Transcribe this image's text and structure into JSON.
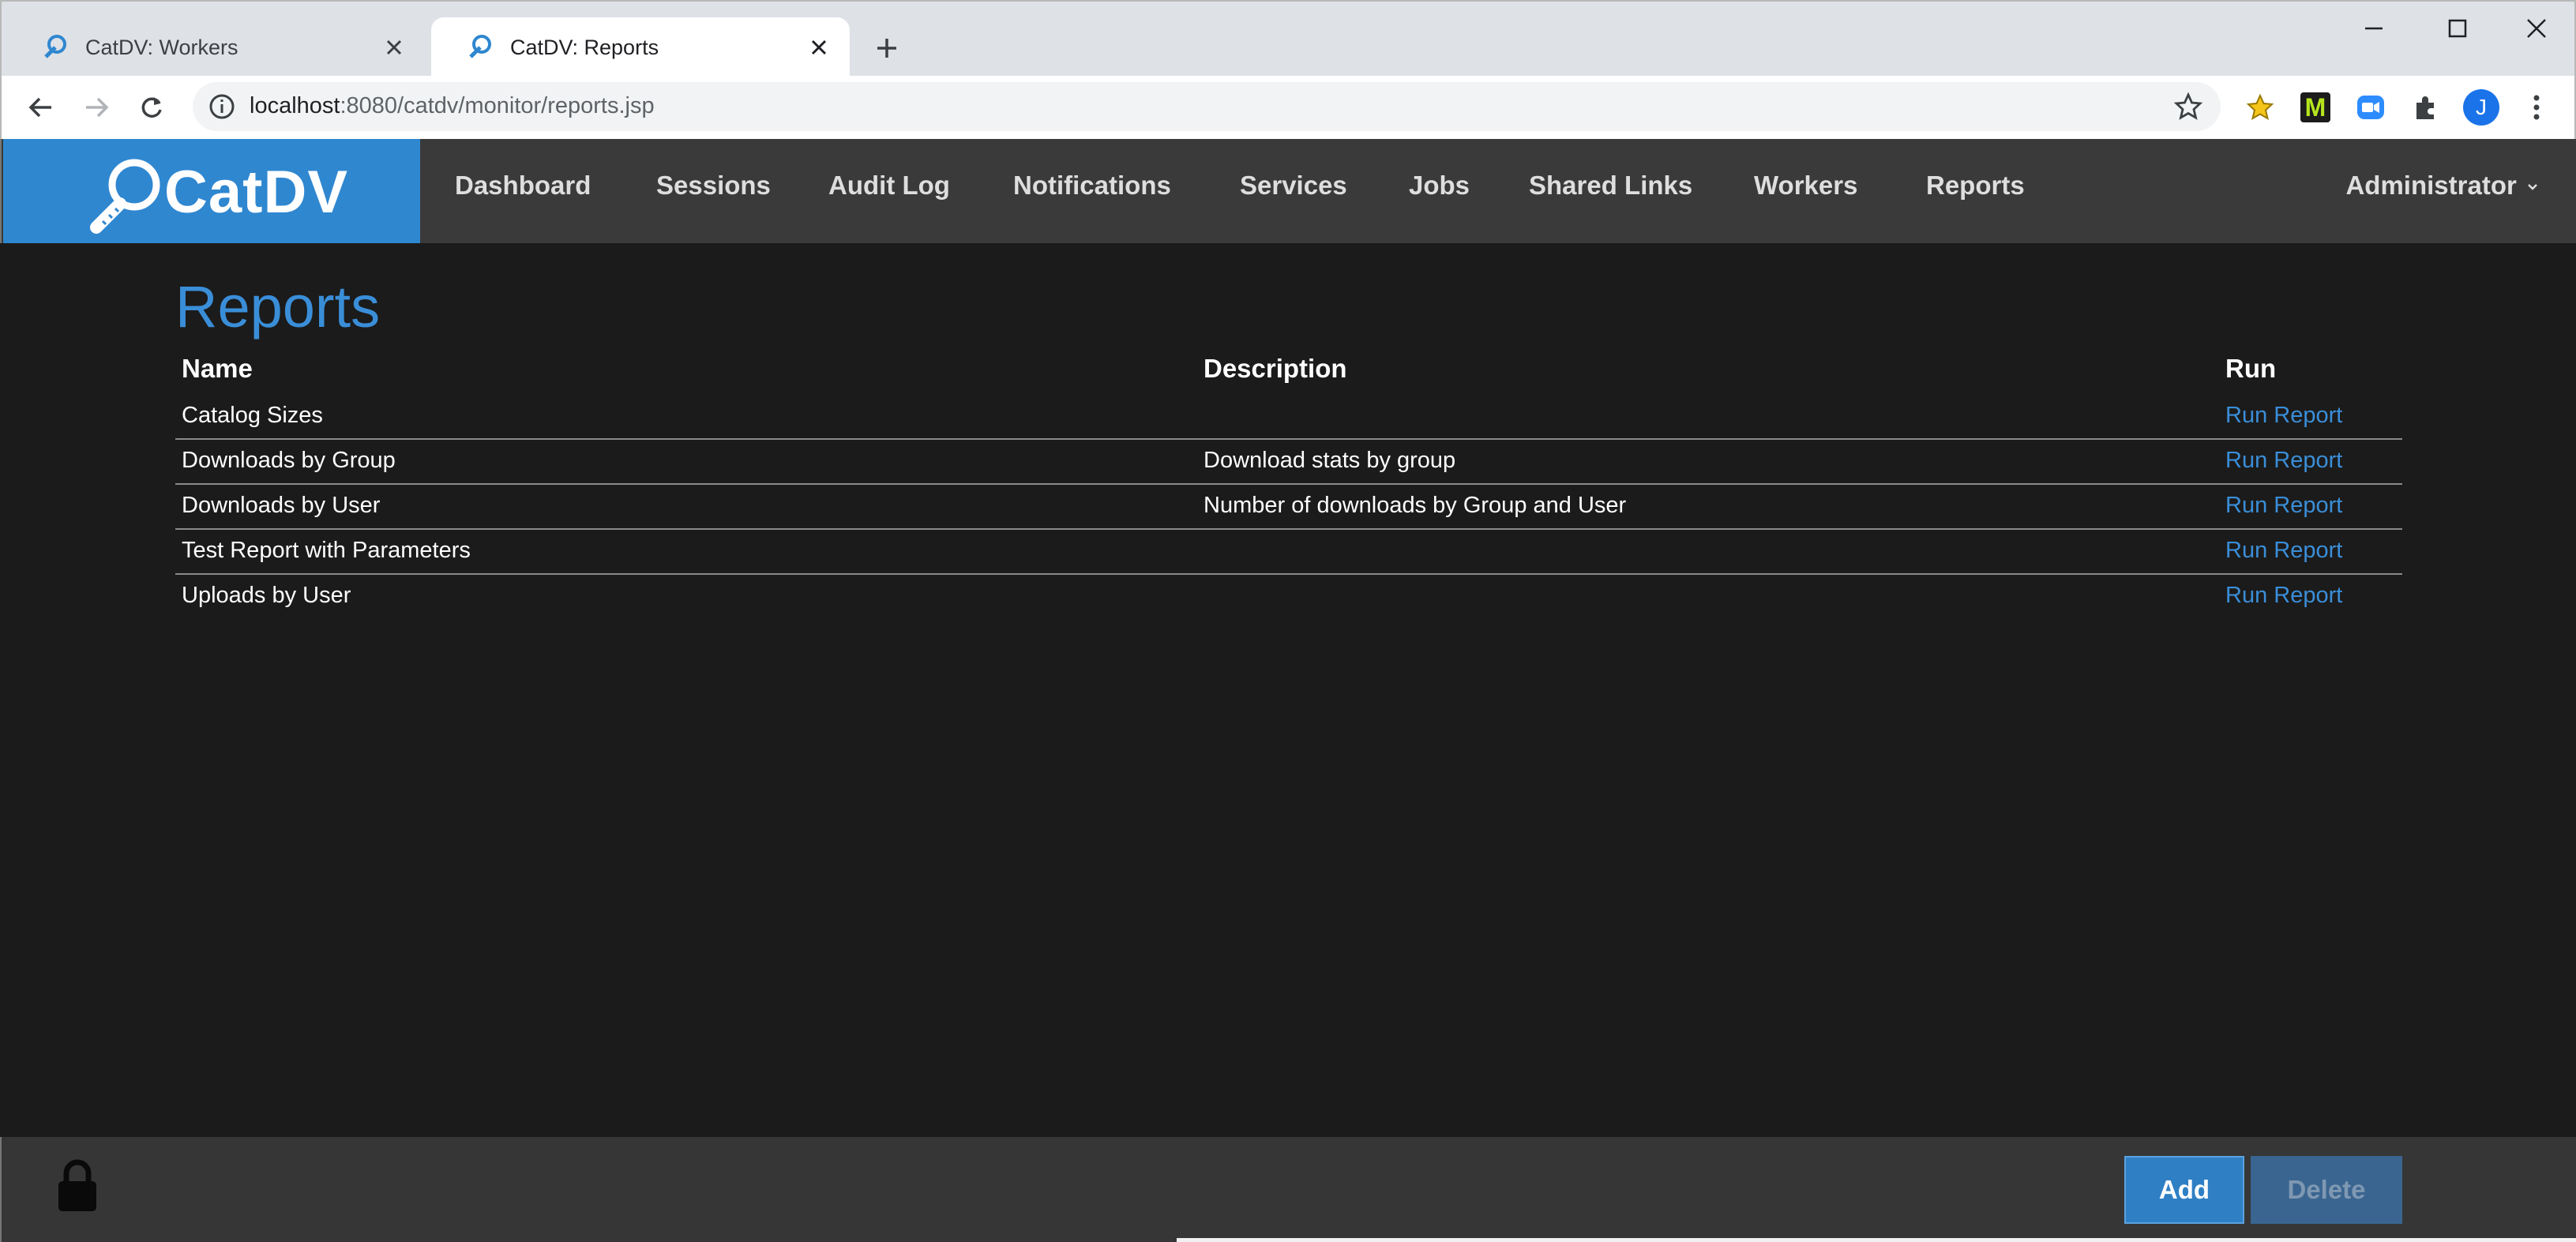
{
  "browser": {
    "tabs": [
      {
        "title": "CatDV: Workers",
        "active": false
      },
      {
        "title": "CatDV: Reports",
        "active": true
      }
    ],
    "url_host": "localhost",
    "url_rest": ":8080/catdv/monitor/reports.jsp",
    "profile_initial": "J",
    "extension_m_label": "M"
  },
  "app": {
    "logo_text": "CatDV",
    "nav": [
      "Dashboard",
      "Sessions",
      "Audit Log",
      "Notifications",
      "Services",
      "Jobs",
      "Shared Links",
      "Workers",
      "Reports"
    ],
    "user_menu": "Administrator"
  },
  "page": {
    "title": "Reports",
    "columns": {
      "name": "Name",
      "description": "Description",
      "run": "Run"
    },
    "rows": [
      {
        "name": "Catalog Sizes",
        "description": "",
        "run": "Run Report"
      },
      {
        "name": "Downloads by Group",
        "description": "Download stats by group",
        "run": "Run Report"
      },
      {
        "name": "Downloads by User",
        "description": "Number of downloads by Group and User",
        "run": "Run Report"
      },
      {
        "name": "Test Report with Parameters",
        "description": "",
        "run": "Run Report"
      },
      {
        "name": "Uploads by User",
        "description": "",
        "run": "Run Report"
      }
    ]
  },
  "footer": {
    "add_label": "Add",
    "delete_label": "Delete"
  },
  "colors": {
    "accent": "#2f87d0",
    "link": "#3a8ed8",
    "background": "#1b1b1b",
    "header": "#3a3a3a"
  }
}
